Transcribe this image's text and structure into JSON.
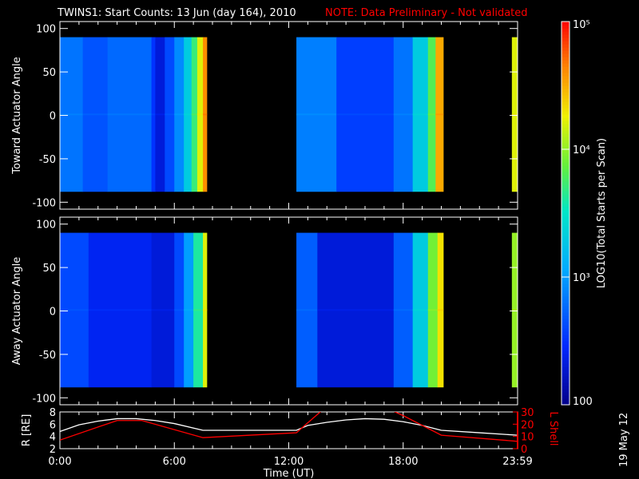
{
  "title": "TWINS1: Start Counts: 13 Jun (day 164), 2010",
  "note": "NOTE: Data Preliminary - Not validated",
  "date_stamp": "19 May 12",
  "colors": {
    "note": "#ff0000",
    "lshell": "#ff0000",
    "r": "#ffffff"
  },
  "chart_data": [
    {
      "type": "heatmap",
      "name": "toward",
      "ylabel": "Toward Actuator Angle",
      "ylim": [
        -108,
        108
      ],
      "yticks": [
        "100",
        "50",
        "0",
        "-50",
        "-100"
      ],
      "ytickvals": [
        100,
        50,
        0,
        -50,
        -100
      ],
      "angle_range": [
        -88,
        90
      ],
      "columns": [
        [
          0,
          1.2,
          2.8
        ],
        [
          1.2,
          2.5,
          2.65
        ],
        [
          2.5,
          4.8,
          2.75
        ],
        [
          4.8,
          5.0,
          2.5
        ],
        [
          5.0,
          5.5,
          2.3
        ],
        [
          5.5,
          6.0,
          2.6
        ],
        [
          6.0,
          6.5,
          2.9
        ],
        [
          6.5,
          6.9,
          3.3
        ],
        [
          6.9,
          7.2,
          3.7
        ],
        [
          7.2,
          7.5,
          4.2
        ],
        [
          7.5,
          7.7,
          4.6
        ],
        [
          12.4,
          14.5,
          2.85
        ],
        [
          14.5,
          17.5,
          2.55
        ],
        [
          17.5,
          18.5,
          2.8
        ],
        [
          18.5,
          19.3,
          3.3
        ],
        [
          19.3,
          19.7,
          3.8
        ],
        [
          19.7,
          20.1,
          4.5
        ],
        [
          23.7,
          24,
          4.2
        ]
      ]
    },
    {
      "type": "heatmap",
      "name": "away",
      "ylabel": "Away Actuator Angle",
      "ylim": [
        -108,
        108
      ],
      "yticks": [
        "100",
        "50",
        "0",
        "-50",
        "-100"
      ],
      "ytickvals": [
        100,
        50,
        0,
        -50,
        -100
      ],
      "angle_range": [
        -88,
        90
      ],
      "columns": [
        [
          0,
          1.5,
          2.6
        ],
        [
          1.5,
          4.8,
          2.4
        ],
        [
          4.8,
          6.0,
          2.3
        ],
        [
          6.0,
          6.5,
          2.6
        ],
        [
          6.5,
          7.0,
          3.0
        ],
        [
          7.0,
          7.5,
          3.6
        ],
        [
          7.5,
          7.7,
          4.2
        ],
        [
          12.4,
          13.5,
          2.7
        ],
        [
          13.5,
          17.5,
          2.3
        ],
        [
          17.5,
          18.5,
          2.7
        ],
        [
          18.5,
          19.3,
          3.3
        ],
        [
          19.3,
          19.8,
          3.9
        ],
        [
          19.8,
          20.1,
          4.3
        ],
        [
          23.7,
          24,
          4.0
        ]
      ]
    },
    {
      "type": "line",
      "xlabel": "Time (UT)",
      "xticks": [
        "0:00",
        "6:00",
        "12:00",
        "18:00",
        "23:59"
      ],
      "xtickvals": [
        0,
        6,
        12,
        18,
        24
      ],
      "left": {
        "label": "R [RE]",
        "ylim": [
          2,
          8
        ],
        "yticks": [
          "2",
          "4",
          "6",
          "8"
        ],
        "ytickvals": [
          2,
          4,
          6,
          8
        ],
        "x": [
          0,
          1,
          2,
          3,
          4,
          5,
          6,
          7.5,
          12.4,
          13,
          14,
          15,
          16,
          17,
          18,
          19,
          20,
          22,
          24
        ],
        "y": [
          4.8,
          5.9,
          6.5,
          6.9,
          6.9,
          6.6,
          6.1,
          5.0,
          5.0,
          5.8,
          6.3,
          6.7,
          6.9,
          6.8,
          6.4,
          5.8,
          5.0,
          4.6,
          4.2
        ]
      },
      "right": {
        "label": "L Shell",
        "ylim": [
          0,
          30
        ],
        "yticks": [
          "0",
          "10",
          "20",
          "30"
        ],
        "ytickvals": [
          0,
          10,
          20,
          30
        ],
        "x": [
          0,
          3,
          4.3,
          7.5,
          12.4,
          13.8,
          17.3,
          18,
          20,
          24
        ],
        "y": [
          7,
          23,
          23,
          9,
          13,
          32,
          32,
          27,
          11,
          6
        ]
      }
    },
    {
      "type": "colorbar",
      "label": "LOG10(Total Starts per Scan)",
      "range_log": [
        2,
        5
      ],
      "ticks": [
        "100",
        "10³",
        "10⁴",
        "10⁵"
      ],
      "tickvals": [
        2,
        3,
        4,
        5
      ]
    }
  ]
}
